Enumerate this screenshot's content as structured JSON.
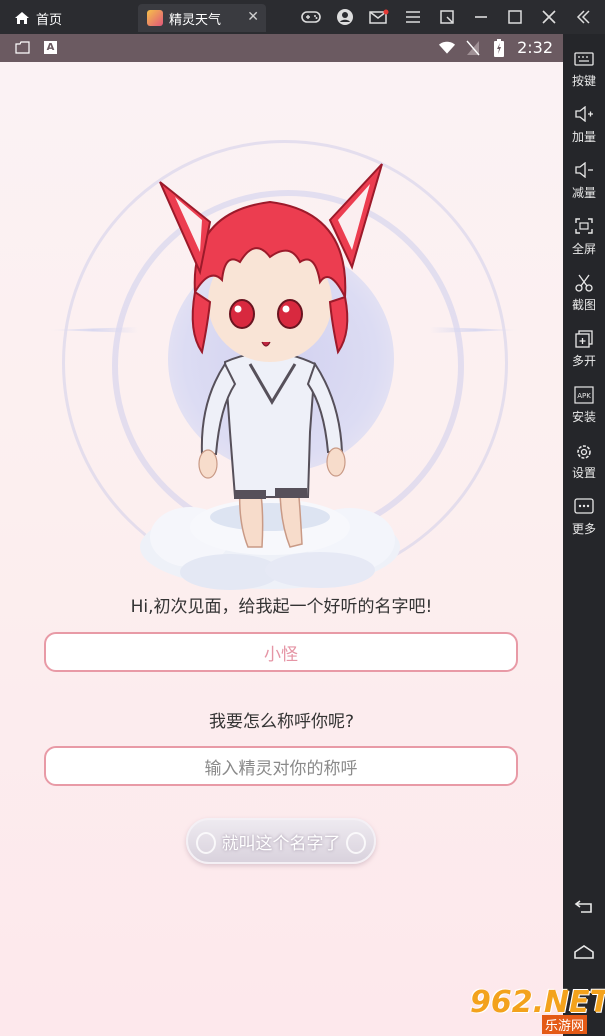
{
  "topbar": {
    "home_label": "首页",
    "app_tab_label": "精灵天气",
    "tab_close": "✕"
  },
  "statusbar": {
    "time": "2:32"
  },
  "app": {
    "greeting": "Hi,初次见面，给我起一个好听的名字吧!",
    "name_input_value": "小怪",
    "question": "我要怎么称呼你呢?",
    "call_input_placeholder": "输入精灵对你的称呼",
    "confirm_button": "就叫这个名字了"
  },
  "sidebar": {
    "items": [
      {
        "icon": "keyboard-icon",
        "label": "按键"
      },
      {
        "icon": "volume-up-icon",
        "label": "加量"
      },
      {
        "icon": "volume-down-icon",
        "label": "减量"
      },
      {
        "icon": "fullscreen-icon",
        "label": "全屏"
      },
      {
        "icon": "scissors-icon",
        "label": "截图"
      },
      {
        "icon": "multi-open-icon",
        "label": "多开"
      },
      {
        "icon": "apk-install-icon",
        "label": "安装"
      },
      {
        "icon": "settings-icon",
        "label": "设置"
      },
      {
        "icon": "more-icon",
        "label": "更多"
      }
    ]
  },
  "watermark": {
    "logo": "962.NET",
    "sub": "乐游网"
  },
  "colors": {
    "accent_pink": "#e89aa6",
    "status_bar": "#6b5a61",
    "sidebar_bg": "#25262a"
  }
}
